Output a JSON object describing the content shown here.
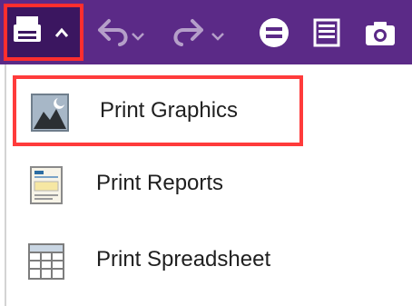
{
  "toolbar": {
    "background": "#5b2a87",
    "highlight_color": "#ff2e2e",
    "buttons": [
      {
        "name": "print-dropdown-button",
        "icon": "printer-icon"
      },
      {
        "name": "undo-button",
        "icon": "undo-icon"
      },
      {
        "name": "redo-button",
        "icon": "redo-icon"
      },
      {
        "name": "equals-button",
        "icon": "equals-circle-icon"
      },
      {
        "name": "document-button",
        "icon": "document-list-icon"
      },
      {
        "name": "camera-button",
        "icon": "camera-icon"
      }
    ]
  },
  "menu": {
    "items": [
      {
        "label": "Print Graphics",
        "icon": "graphics-image-icon",
        "selected": true
      },
      {
        "label": "Print Reports",
        "icon": "report-icon",
        "selected": false
      },
      {
        "label": "Print Spreadsheet",
        "icon": "spreadsheet-icon",
        "selected": false
      }
    ],
    "selection_color": "#ff3b3b"
  }
}
